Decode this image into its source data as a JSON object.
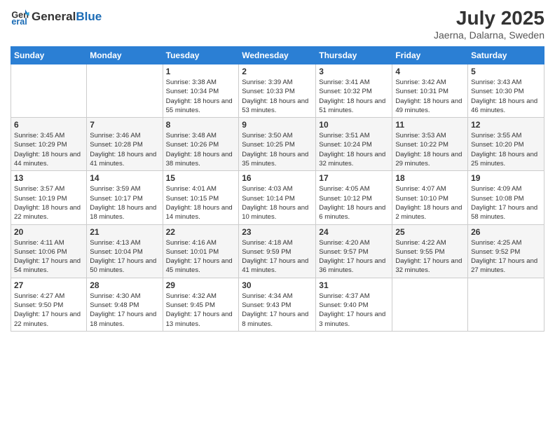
{
  "header": {
    "logo_general": "General",
    "logo_blue": "Blue",
    "month_title": "July 2025",
    "location": "Jaerna, Dalarna, Sweden"
  },
  "weekdays": [
    "Sunday",
    "Monday",
    "Tuesday",
    "Wednesday",
    "Thursday",
    "Friday",
    "Saturday"
  ],
  "weeks": [
    [
      {
        "day": "",
        "info": ""
      },
      {
        "day": "",
        "info": ""
      },
      {
        "day": "1",
        "info": "Sunrise: 3:38 AM\nSunset: 10:34 PM\nDaylight: 18 hours and 55 minutes."
      },
      {
        "day": "2",
        "info": "Sunrise: 3:39 AM\nSunset: 10:33 PM\nDaylight: 18 hours and 53 minutes."
      },
      {
        "day": "3",
        "info": "Sunrise: 3:41 AM\nSunset: 10:32 PM\nDaylight: 18 hours and 51 minutes."
      },
      {
        "day": "4",
        "info": "Sunrise: 3:42 AM\nSunset: 10:31 PM\nDaylight: 18 hours and 49 minutes."
      },
      {
        "day": "5",
        "info": "Sunrise: 3:43 AM\nSunset: 10:30 PM\nDaylight: 18 hours and 46 minutes."
      }
    ],
    [
      {
        "day": "6",
        "info": "Sunrise: 3:45 AM\nSunset: 10:29 PM\nDaylight: 18 hours and 44 minutes."
      },
      {
        "day": "7",
        "info": "Sunrise: 3:46 AM\nSunset: 10:28 PM\nDaylight: 18 hours and 41 minutes."
      },
      {
        "day": "8",
        "info": "Sunrise: 3:48 AM\nSunset: 10:26 PM\nDaylight: 18 hours and 38 minutes."
      },
      {
        "day": "9",
        "info": "Sunrise: 3:50 AM\nSunset: 10:25 PM\nDaylight: 18 hours and 35 minutes."
      },
      {
        "day": "10",
        "info": "Sunrise: 3:51 AM\nSunset: 10:24 PM\nDaylight: 18 hours and 32 minutes."
      },
      {
        "day": "11",
        "info": "Sunrise: 3:53 AM\nSunset: 10:22 PM\nDaylight: 18 hours and 29 minutes."
      },
      {
        "day": "12",
        "info": "Sunrise: 3:55 AM\nSunset: 10:20 PM\nDaylight: 18 hours and 25 minutes."
      }
    ],
    [
      {
        "day": "13",
        "info": "Sunrise: 3:57 AM\nSunset: 10:19 PM\nDaylight: 18 hours and 22 minutes."
      },
      {
        "day": "14",
        "info": "Sunrise: 3:59 AM\nSunset: 10:17 PM\nDaylight: 18 hours and 18 minutes."
      },
      {
        "day": "15",
        "info": "Sunrise: 4:01 AM\nSunset: 10:15 PM\nDaylight: 18 hours and 14 minutes."
      },
      {
        "day": "16",
        "info": "Sunrise: 4:03 AM\nSunset: 10:14 PM\nDaylight: 18 hours and 10 minutes."
      },
      {
        "day": "17",
        "info": "Sunrise: 4:05 AM\nSunset: 10:12 PM\nDaylight: 18 hours and 6 minutes."
      },
      {
        "day": "18",
        "info": "Sunrise: 4:07 AM\nSunset: 10:10 PM\nDaylight: 18 hours and 2 minutes."
      },
      {
        "day": "19",
        "info": "Sunrise: 4:09 AM\nSunset: 10:08 PM\nDaylight: 17 hours and 58 minutes."
      }
    ],
    [
      {
        "day": "20",
        "info": "Sunrise: 4:11 AM\nSunset: 10:06 PM\nDaylight: 17 hours and 54 minutes."
      },
      {
        "day": "21",
        "info": "Sunrise: 4:13 AM\nSunset: 10:04 PM\nDaylight: 17 hours and 50 minutes."
      },
      {
        "day": "22",
        "info": "Sunrise: 4:16 AM\nSunset: 10:01 PM\nDaylight: 17 hours and 45 minutes."
      },
      {
        "day": "23",
        "info": "Sunrise: 4:18 AM\nSunset: 9:59 PM\nDaylight: 17 hours and 41 minutes."
      },
      {
        "day": "24",
        "info": "Sunrise: 4:20 AM\nSunset: 9:57 PM\nDaylight: 17 hours and 36 minutes."
      },
      {
        "day": "25",
        "info": "Sunrise: 4:22 AM\nSunset: 9:55 PM\nDaylight: 17 hours and 32 minutes."
      },
      {
        "day": "26",
        "info": "Sunrise: 4:25 AM\nSunset: 9:52 PM\nDaylight: 17 hours and 27 minutes."
      }
    ],
    [
      {
        "day": "27",
        "info": "Sunrise: 4:27 AM\nSunset: 9:50 PM\nDaylight: 17 hours and 22 minutes."
      },
      {
        "day": "28",
        "info": "Sunrise: 4:30 AM\nSunset: 9:48 PM\nDaylight: 17 hours and 18 minutes."
      },
      {
        "day": "29",
        "info": "Sunrise: 4:32 AM\nSunset: 9:45 PM\nDaylight: 17 hours and 13 minutes."
      },
      {
        "day": "30",
        "info": "Sunrise: 4:34 AM\nSunset: 9:43 PM\nDaylight: 17 hours and 8 minutes."
      },
      {
        "day": "31",
        "info": "Sunrise: 4:37 AM\nSunset: 9:40 PM\nDaylight: 17 hours and 3 minutes."
      },
      {
        "day": "",
        "info": ""
      },
      {
        "day": "",
        "info": ""
      }
    ]
  ]
}
